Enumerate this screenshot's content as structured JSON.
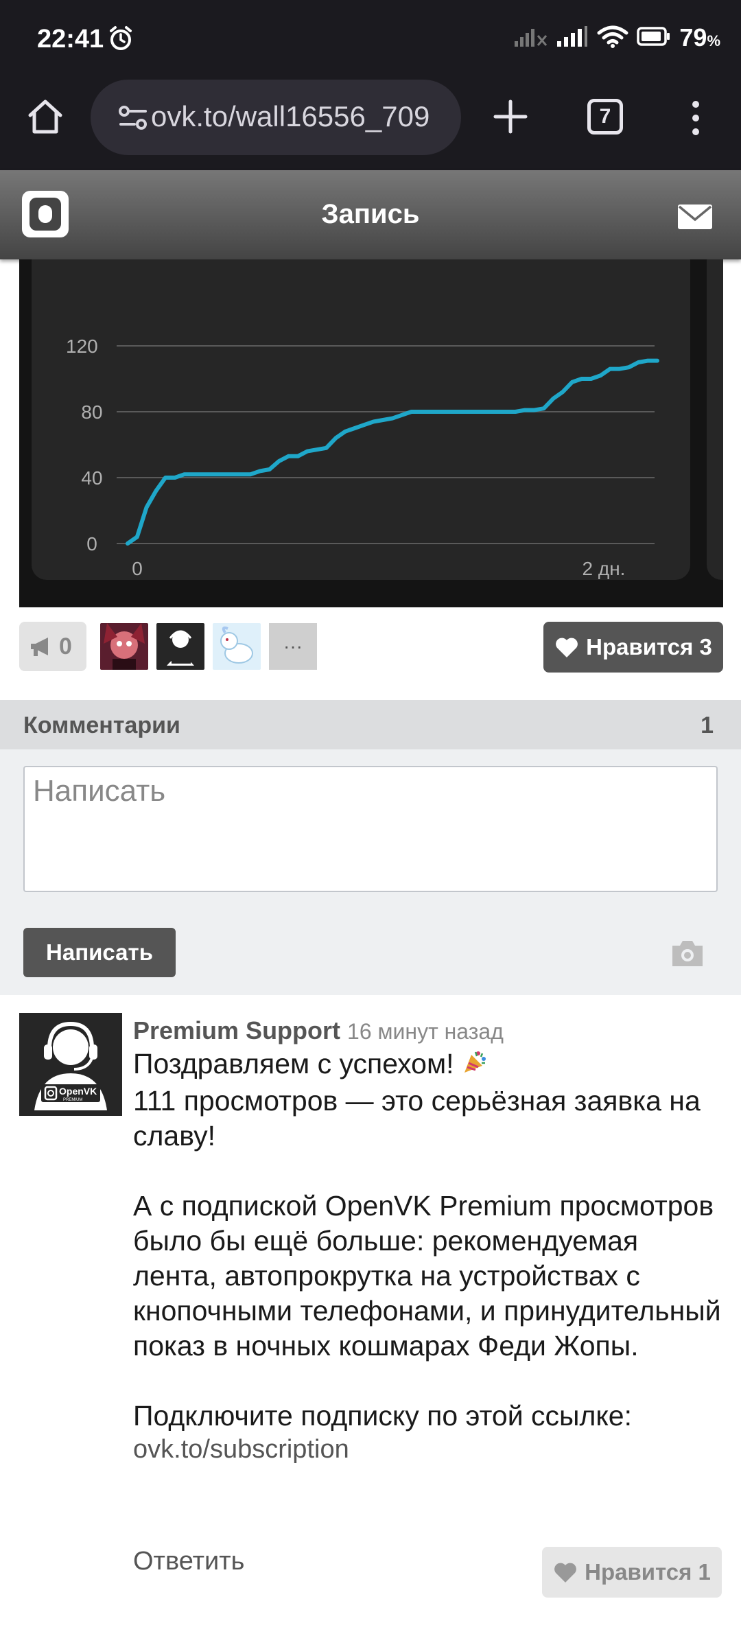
{
  "status_bar": {
    "time": "22:41",
    "battery_percent": "79",
    "battery_unit": "%"
  },
  "browser": {
    "url": "ovk.to/wall16556_709",
    "tab_count": "7"
  },
  "header": {
    "title": "Запись"
  },
  "chart_data": {
    "type": "line",
    "x_tick_labels": [
      "0",
      "2 дн."
    ],
    "y_ticks": [
      0,
      40,
      80,
      120
    ],
    "ylim": [
      0,
      120
    ],
    "grid": true,
    "series": [
      {
        "color": "#1fa7c9",
        "values": [
          0,
          4,
          22,
          32,
          40,
          40,
          42,
          42,
          42,
          42,
          42,
          42,
          42,
          42,
          44,
          45,
          50,
          53,
          53,
          56,
          57,
          58,
          64,
          68,
          70,
          72,
          74,
          75,
          76,
          78,
          80,
          80,
          80,
          80,
          80,
          80,
          80,
          80,
          80,
          80,
          80,
          80,
          81,
          81,
          82,
          88,
          92,
          98,
          100,
          100,
          102,
          106,
          106,
          107,
          110,
          111,
          111
        ]
      }
    ]
  },
  "post_actions": {
    "repost_count": "0",
    "like_label": "Нравится 3",
    "more_likers": "···"
  },
  "comments": {
    "title": "Комментарии",
    "count": "1",
    "placeholder": "Написать",
    "submit_label": "Написать"
  },
  "comment": {
    "author": "Premium Support",
    "time": "16 минут назад",
    "text_line1": "Поздравляем с успехом!",
    "text_rest": "111 просмотров — это серьёзная заявка на славу!\n\nА с подпиской OpenVK Premium просмотров было бы ещё больше: рекомендуемая лента, автопрокрутка на устройствах с кнопочными телефонами, и принудительный показ в ночных кошмарах Феди Жопы.\n\nПодключите подписку по этой ссылке:",
    "link": "ovk.to/subscription",
    "reply_label": "Ответить",
    "like_label": "Нравится 1",
    "avatar_brand": "OpenVK",
    "avatar_sub": "PREMIUM"
  }
}
